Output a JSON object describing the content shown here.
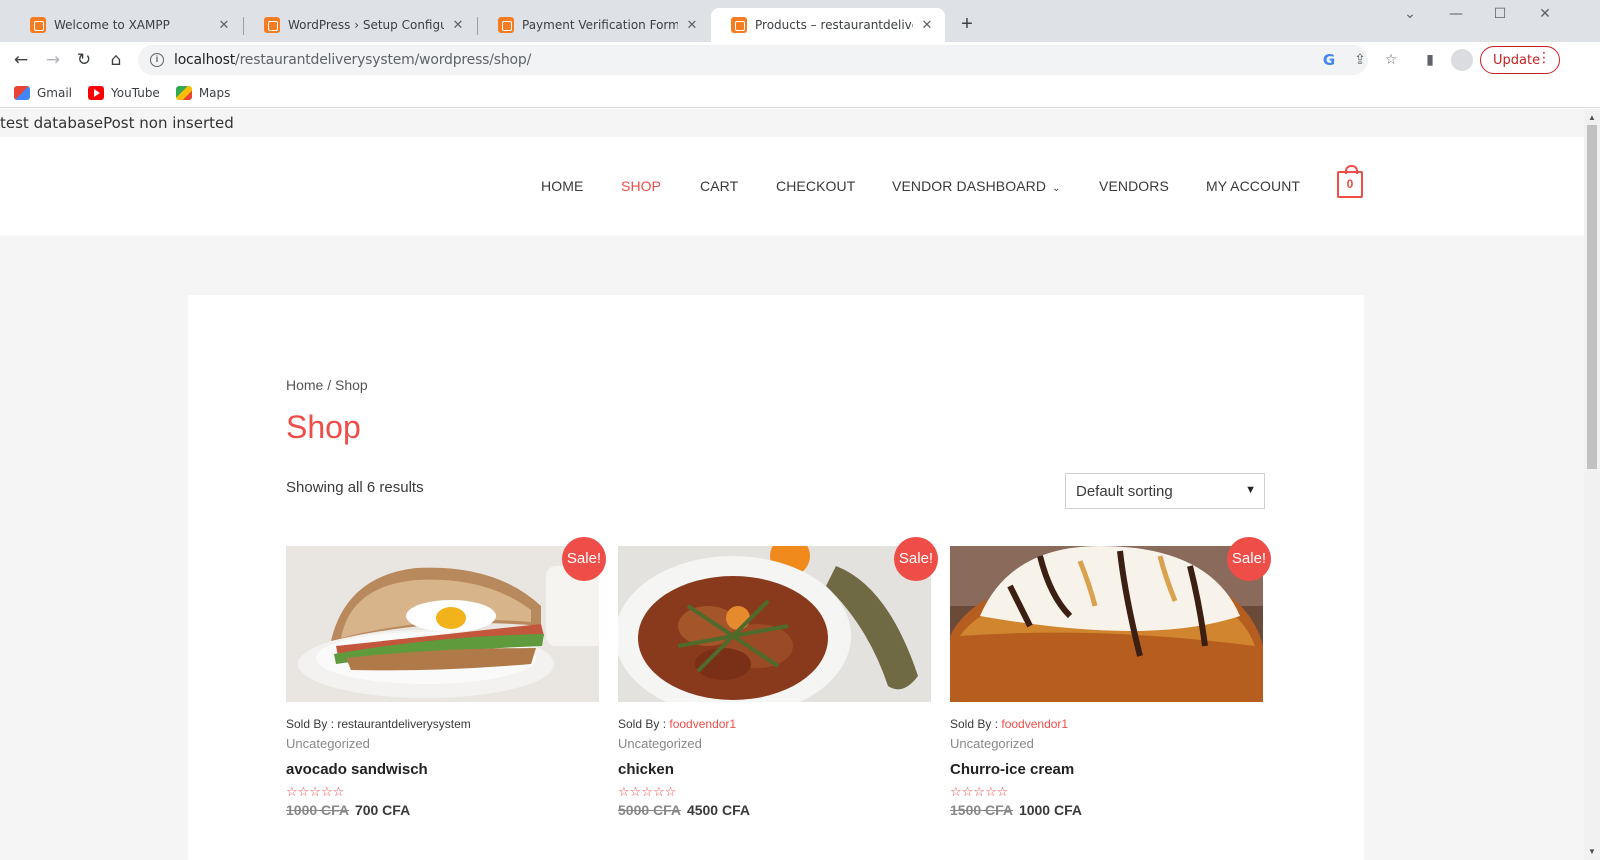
{
  "browser": {
    "tabs": [
      {
        "title": "Welcome to XAMPP",
        "active": false
      },
      {
        "title": "WordPress › Setup Configuration",
        "active": false
      },
      {
        "title": "Payment Verification Form – resta",
        "active": false
      },
      {
        "title": "Products – restaurantdeliverysyst",
        "active": true
      }
    ],
    "new_tab_label": "+",
    "url_host": "localhost",
    "url_path": "/restaurantdeliverysystem/wordpress/shop/",
    "update_label": "Update",
    "bookmarks": [
      {
        "label": "Gmail",
        "icon": "gmail-icon"
      },
      {
        "label": "YouTube",
        "icon": "youtube-icon"
      },
      {
        "label": "Maps",
        "icon": "maps-icon"
      }
    ]
  },
  "page": {
    "debug_message": "test databasePost non inserted",
    "menu": [
      {
        "label": "HOME",
        "current": false
      },
      {
        "label": "SHOP",
        "current": true
      },
      {
        "label": "CART",
        "current": false
      },
      {
        "label": "CHECKOUT",
        "current": false
      },
      {
        "label": "VENDOR DASHBOARD",
        "current": false,
        "has_submenu": true
      },
      {
        "label": "VENDORS",
        "current": false
      },
      {
        "label": "MY ACCOUNT",
        "current": false
      }
    ],
    "cart_count": "0",
    "breadcrumb": "Home / Shop",
    "title": "Shop",
    "result_count": "Showing all 6 results",
    "sort_selected": "Default sorting",
    "sold_by_prefix": "Sold By : ",
    "sale_label": "Sale!",
    "products": [
      {
        "vendor": "restaurantdeliverysystem",
        "category": "Uncategorized",
        "name": "avocado sandwisch",
        "regular_price": "1000 CFA",
        "sale_price": "700 CFA",
        "stars": "☆☆☆☆☆"
      },
      {
        "vendor": "foodvendor1",
        "category": "Uncategorized",
        "name": "chicken",
        "regular_price": "5000 CFA",
        "sale_price": "4500 CFA",
        "stars": "☆☆☆☆☆"
      },
      {
        "vendor": "foodvendor1",
        "category": "Uncategorized",
        "name": "Churro-ice cream",
        "regular_price": "1500 CFA",
        "sale_price": "1000 CFA",
        "stars": "☆☆☆☆☆"
      }
    ]
  },
  "colors": {
    "accent": "#ef4d48",
    "update_red": "#c5221f",
    "tabstrip": "#dee1e6"
  }
}
